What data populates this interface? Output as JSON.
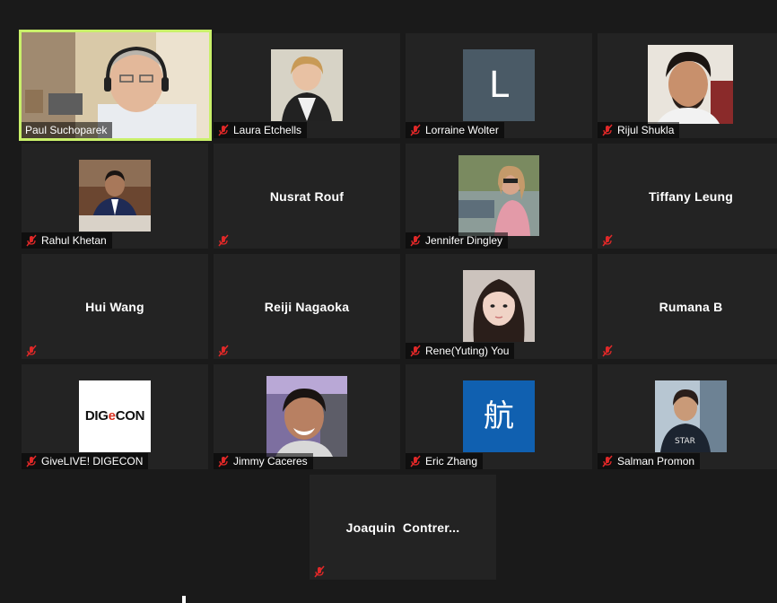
{
  "participants": [
    {
      "name": "Paul Suchoparek",
      "muted": false,
      "video": true,
      "active": true
    },
    {
      "name": "Laura Etchells",
      "muted": true,
      "avatar": "photo"
    },
    {
      "name": "Lorraine Wolter",
      "muted": true,
      "avatar": "letter",
      "letter": "L"
    },
    {
      "name": "Rijul Shukla",
      "muted": true,
      "avatar": "photo"
    },
    {
      "name": "Rahul Khetan",
      "muted": true,
      "avatar": "photo"
    },
    {
      "name": "Nusrat Rouf",
      "muted": true,
      "avatar": "none"
    },
    {
      "name": "Jennifer Dingley",
      "muted": true,
      "avatar": "photo"
    },
    {
      "name": "Tiffany Leung",
      "muted": true,
      "avatar": "none"
    },
    {
      "name": "Hui Wang",
      "muted": true,
      "avatar": "none"
    },
    {
      "name": "Reiji Nagaoka",
      "muted": true,
      "avatar": "none"
    },
    {
      "name": "Rene(Yuting) You",
      "muted": true,
      "avatar": "photo"
    },
    {
      "name": "Rumana B",
      "muted": true,
      "avatar": "none"
    },
    {
      "name": "GiveLIVE! DIGECON",
      "muted": true,
      "avatar": "logo",
      "logo_text": "DIGeCON"
    },
    {
      "name": "Jimmy Caceres",
      "muted": true,
      "avatar": "photo"
    },
    {
      "name": "Eric Zhang",
      "muted": true,
      "avatar": "cjk",
      "glyph": "航"
    },
    {
      "name": "Salman Promon",
      "muted": true,
      "avatar": "photo"
    },
    {
      "name": "Joaquin  Contrer...",
      "muted": true,
      "avatar": "none"
    }
  ],
  "colors": {
    "background": "#1a1a1a",
    "tile": "#232323",
    "active_border": "#c9f06a",
    "mute_icon": "#e02828"
  }
}
